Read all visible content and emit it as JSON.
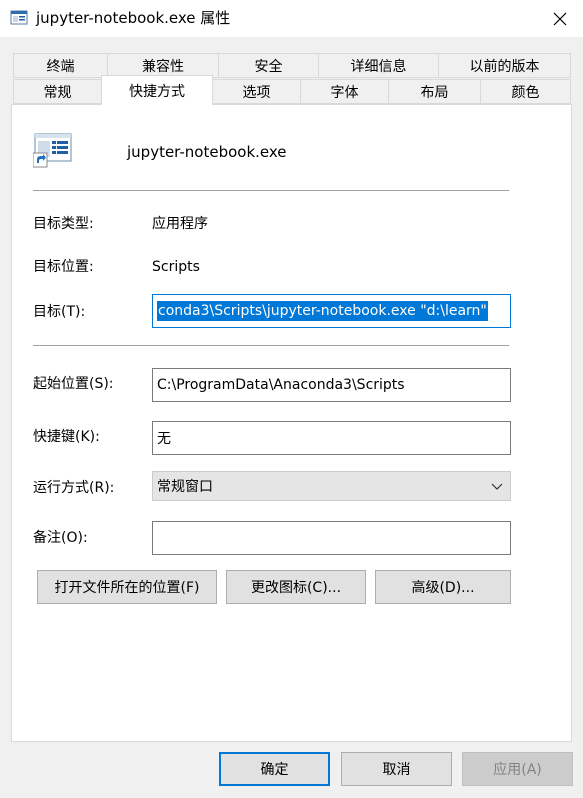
{
  "window": {
    "title": "jupyter-notebook.exe 属性",
    "close_glyph": "✕"
  },
  "tabs_row1": [
    {
      "label": "终端"
    },
    {
      "label": "兼容性"
    },
    {
      "label": "安全"
    },
    {
      "label": "详细信息"
    },
    {
      "label": "以前的版本"
    }
  ],
  "tabs_row2": [
    {
      "label": "常规"
    },
    {
      "label": "快捷方式"
    },
    {
      "label": "选项"
    },
    {
      "label": "字体"
    },
    {
      "label": "布局"
    },
    {
      "label": "颜色"
    }
  ],
  "active_tab": "快捷方式",
  "shortcut": {
    "name": "jupyter-notebook.exe",
    "target_type_label": "目标类型:",
    "target_type_value": "应用程序",
    "target_location_label": "目标位置:",
    "target_location_value": "Scripts",
    "target_label": "目标(T):",
    "target_value": "conda3\\Scripts\\jupyter-notebook.exe \"d:\\learn\"",
    "start_in_label": "起始位置(S):",
    "start_in_value": "C:\\ProgramData\\Anaconda3\\Scripts",
    "hotkey_label": "快捷键(K):",
    "hotkey_value": "无",
    "run_label": "运行方式(R):",
    "run_value": "常规窗口",
    "comment_label": "备注(O):",
    "comment_value": ""
  },
  "buttons": {
    "open_location": "打开文件所在的位置(F)",
    "change_icon": "更改图标(C)...",
    "advanced": "高级(D)...",
    "ok": "确定",
    "cancel": "取消",
    "apply": "应用(A)"
  },
  "colors": {
    "accent": "#0078d7",
    "dialog_bg": "#f0f0f0",
    "panel_bg": "#ffffff"
  }
}
